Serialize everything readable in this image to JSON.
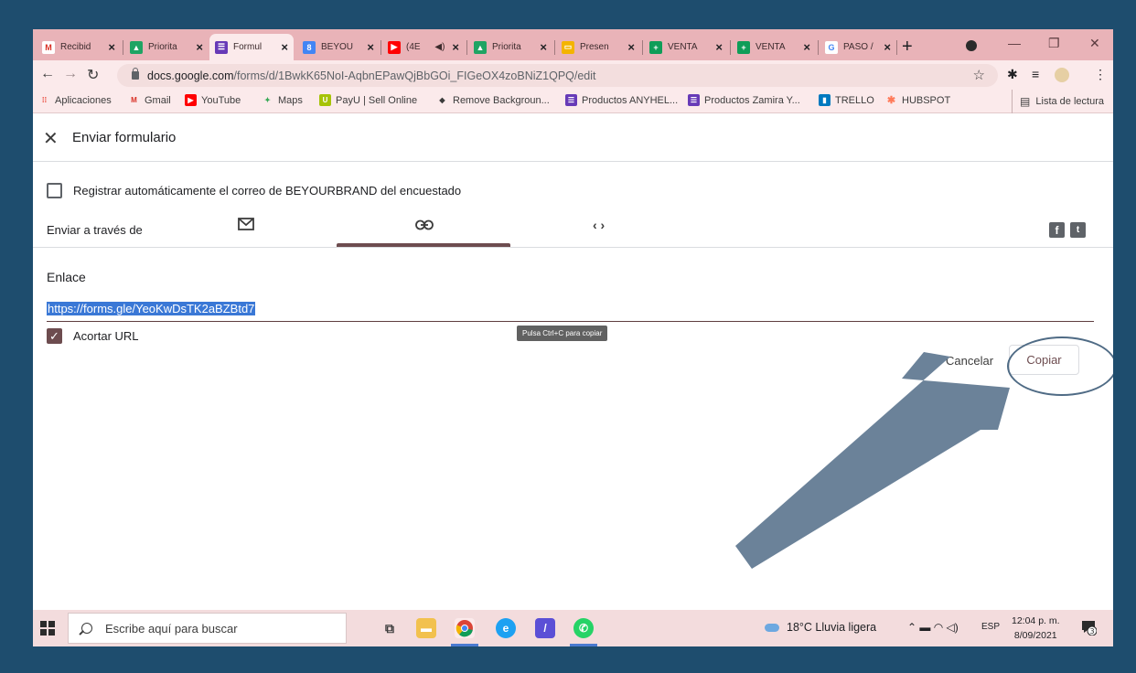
{
  "browser": {
    "tabs": [
      {
        "label": "Recibid",
        "icon": "gmail-icon",
        "color": "#d93025",
        "glyph": "M"
      },
      {
        "label": "Priorita",
        "icon": "drive-icon",
        "color": "#1fa463",
        "glyph": "▲"
      },
      {
        "label": "Formul",
        "icon": "forms-icon",
        "color": "#673ab7",
        "glyph": "☰",
        "active": true
      },
      {
        "label": "BEYOU",
        "icon": "calendar-icon",
        "color": "#4285f4",
        "glyph": "8"
      },
      {
        "label": "(4E",
        "icon": "youtube-icon",
        "color": "#ff0000",
        "glyph": "▶"
      },
      {
        "label": "Priorita",
        "icon": "drive-icon",
        "color": "#1fa463",
        "glyph": "▲"
      },
      {
        "label": "Presen",
        "icon": "slides-icon",
        "color": "#f4b400",
        "glyph": "▭"
      },
      {
        "label": "VENTA",
        "icon": "sheets-icon",
        "color": "#0f9d58",
        "glyph": "+"
      },
      {
        "label": "VENTA",
        "icon": "sheets-icon",
        "color": "#0f9d58",
        "glyph": "+"
      },
      {
        "label": "PASO /",
        "icon": "google-icon",
        "color": "#4285f4",
        "glyph": "G"
      }
    ],
    "new_tab": "+",
    "window_controls": {
      "minimize": "—",
      "restore": "❐",
      "close": "✕"
    },
    "url_domain": "docs.google.com",
    "url_path": "/forms/d/1BwkK65NoI-AqbnEPawQjBbGOi_FIGeOX4zoBNiZ1QPQ/edit",
    "bookmarks": [
      {
        "label": "Aplicaciones",
        "icon": "apps-grid-icon",
        "color": "#ea4335",
        "glyph": "⋮⋮"
      },
      {
        "label": "Gmail",
        "icon": "gmail-icon",
        "color": "#d93025",
        "glyph": "M"
      },
      {
        "label": "YouTube",
        "icon": "youtube-icon",
        "color": "#ff0000",
        "glyph": "▶"
      },
      {
        "label": "Maps",
        "icon": "maps-icon",
        "color": "#34a853",
        "glyph": "✦"
      },
      {
        "label": "PayU | Sell Online",
        "icon": "payu-icon",
        "color": "#a6c307",
        "glyph": "U"
      },
      {
        "label": "Remove Backgroun...",
        "icon": "remove-bg-icon",
        "color": "#3c3c3c",
        "glyph": "◆"
      },
      {
        "label": "Productos ANYHEL...",
        "icon": "forms-icon",
        "color": "#673ab7",
        "glyph": "☰"
      },
      {
        "label": "Productos Zamira Y...",
        "icon": "forms-icon",
        "color": "#673ab7",
        "glyph": "☰"
      },
      {
        "label": "TRELLO",
        "icon": "trello-icon",
        "color": "#0079bf",
        "glyph": "▮▮"
      },
      {
        "label": "HUBSPOT",
        "icon": "hubspot-icon",
        "color": "#ff7a59",
        "glyph": "✱"
      }
    ],
    "reading_list": "Lista de lectura"
  },
  "dialog": {
    "title": "Enviar formulario",
    "collect_email_label": "Registrar automáticamente el correo de BEYOURBRAND del encuestado",
    "send_via_label": "Enviar a través de",
    "link_heading": "Enlace",
    "link_value": "https://forms.gle/YeoKwDsTK2aBZBtd7",
    "shorten_label": "Acortar URL",
    "tooltip": "Pulsa Ctrl+C para copiar",
    "cancel_label": "Cancelar",
    "copy_label": "Copiar"
  },
  "taskbar": {
    "search_placeholder": "Escribe aquí para buscar",
    "weather": "18°C  Lluvia ligera",
    "language": "ESP",
    "time": "12:04 p. m.",
    "date": "8/09/2021",
    "notification_count": "3"
  },
  "colors": {
    "page_background": "#1e4d6e",
    "tab_strip": "#e9b3b8",
    "theme_accent": "#6d4c4f",
    "selection": "#3a78d6",
    "annotation_arrow": "#6b8299"
  }
}
